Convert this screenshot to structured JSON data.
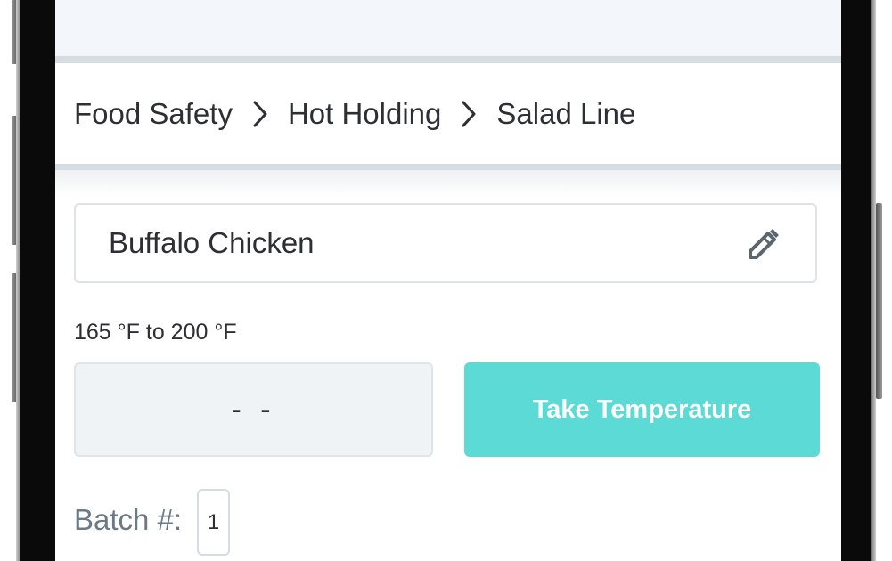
{
  "breadcrumb": {
    "items": [
      "Food Safety",
      "Hot Holding",
      "Salad Line"
    ],
    "separator_icon": "chevron-right-icon"
  },
  "item": {
    "name": "Buffalo Chicken",
    "edit_icon": "pencil-icon"
  },
  "temperature": {
    "range_label": "165 °F to 200 °F",
    "reading": "- -",
    "take_button_label": "Take Temperature"
  },
  "batch": {
    "label": "Batch #:",
    "value": "1"
  },
  "colors": {
    "accent": "#5cdad6",
    "text": "#2c2f33",
    "muted_text": "#6b7a86",
    "divider": "#d5dde3",
    "field_background": "#eff3f6"
  }
}
